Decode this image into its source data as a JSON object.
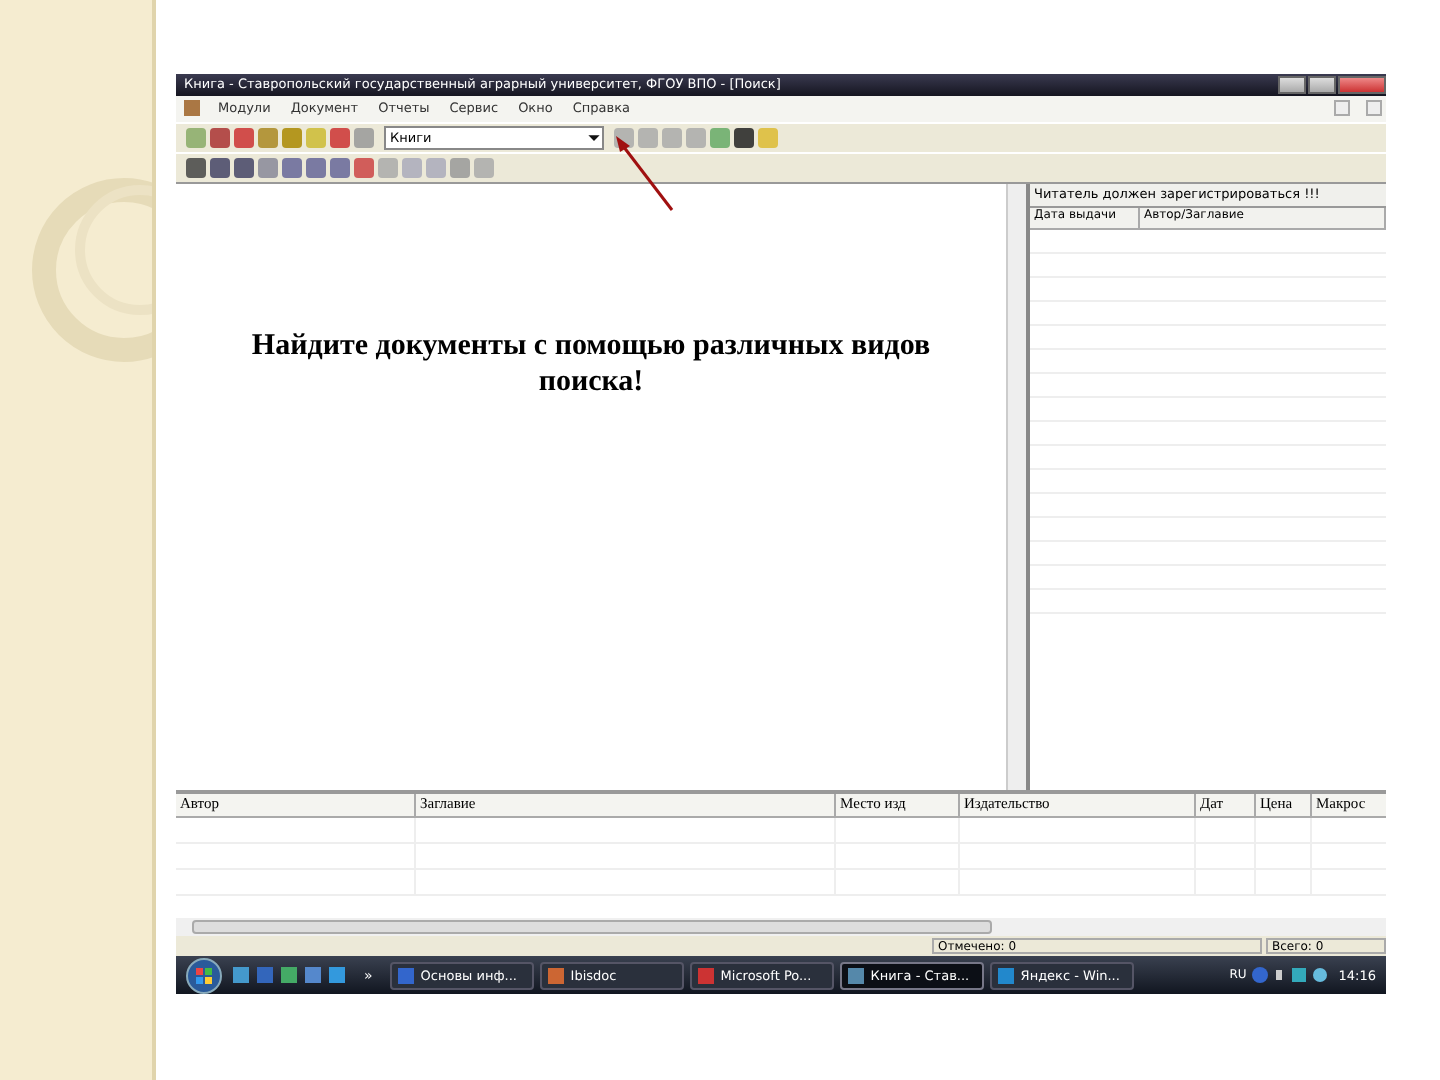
{
  "window": {
    "title": "Книга - Ставропольский государственный аграрный университет, ФГОУ ВПО - [Поиск]"
  },
  "menu": [
    "Модули",
    "Документ",
    "Отчеты",
    "Сервис",
    "Окно",
    "Справка"
  ],
  "toolbar": {
    "combo_value": "Книги"
  },
  "main_message": "Найдите документы с помощью различных видов поиска!",
  "reader_panel": {
    "heading": "Читатель должен зарегистрироваться !!!",
    "columns": [
      "Дата выдачи",
      "Автор/Заглавие"
    ]
  },
  "results": {
    "columns": [
      "Автор",
      "Заглавие",
      "Место изд",
      "Издательство",
      "Дат",
      "Цена",
      "Макрос"
    ]
  },
  "status_bar": [
    "Отмечено: 0",
    "Всего: 0"
  ],
  "taskbar": {
    "more": "»",
    "buttons": [
      {
        "label": "Основы инф...",
        "selected": false
      },
      {
        "label": "Ibisdoc",
        "selected": false
      },
      {
        "label": "Microsoft Po...",
        "selected": false
      },
      {
        "label": "Книга - Став...",
        "selected": true
      },
      {
        "label": "Яндекс - Win...",
        "selected": false
      }
    ],
    "language": "RU",
    "clock": "14:16"
  }
}
